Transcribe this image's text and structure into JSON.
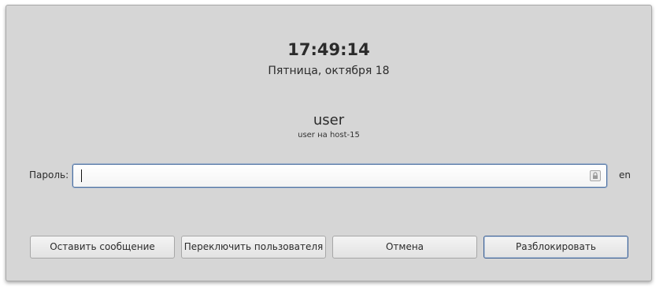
{
  "clock": {
    "time": "17:49:14",
    "date": "Пятница, октября 18"
  },
  "user": {
    "name": "user",
    "host_line": "user на host-15"
  },
  "password": {
    "label": "Пароль:",
    "value": "",
    "lock_icon": "lock-icon"
  },
  "keyboard": {
    "layout": "en"
  },
  "buttons": {
    "leave_message": "Оставить сообщение",
    "switch_user": "Переключить пользователя",
    "cancel": "Отмена",
    "unlock": "Разблокировать"
  },
  "colors": {
    "dialog_bg": "#d6d6d6",
    "focus_border": "#4a6ea0"
  }
}
